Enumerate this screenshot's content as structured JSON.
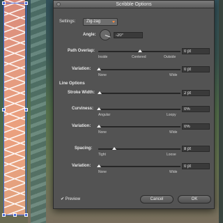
{
  "dialog": {
    "title": "Scribble Options"
  },
  "settings": {
    "label": "Settings:",
    "selected": "Zig-zag"
  },
  "angle": {
    "label": "Angle:",
    "value": "-20°",
    "degrees": -20
  },
  "path_overlap": {
    "label": "Path Overlap:",
    "value": "0 pt",
    "min_label": "Inside",
    "mid_label": "Centered",
    "max_label": "Outside"
  },
  "overlap_variation": {
    "label": "Variation:",
    "value": "0 pt",
    "min_label": "None",
    "max_label": "Wide"
  },
  "line_options": {
    "heading": "Line Options"
  },
  "stroke_width": {
    "label": "Stroke Width:",
    "value": "2 pt"
  },
  "curviness": {
    "label": "Curviness:",
    "value": "0%",
    "min_label": "Angular",
    "max_label": "Loopy"
  },
  "curviness_variation": {
    "label": "Variation:",
    "value": "0%",
    "min_label": "None",
    "max_label": "Wide"
  },
  "spacing": {
    "label": "Spacing:",
    "value": "8 pt",
    "min_label": "Tight",
    "max_label": "Loose"
  },
  "spacing_variation": {
    "label": "Variation:",
    "value": "0 pt",
    "min_label": "None",
    "max_label": "Wide"
  },
  "preview": {
    "label": "Preview",
    "checked": true
  },
  "buttons": {
    "cancel": "Cancel",
    "ok": "OK"
  },
  "colors": {
    "selection": "#4a6bdc",
    "scribble": "#ffffff",
    "fill": "#e39a80",
    "dropdown_arrow": "#ff8a3d"
  }
}
